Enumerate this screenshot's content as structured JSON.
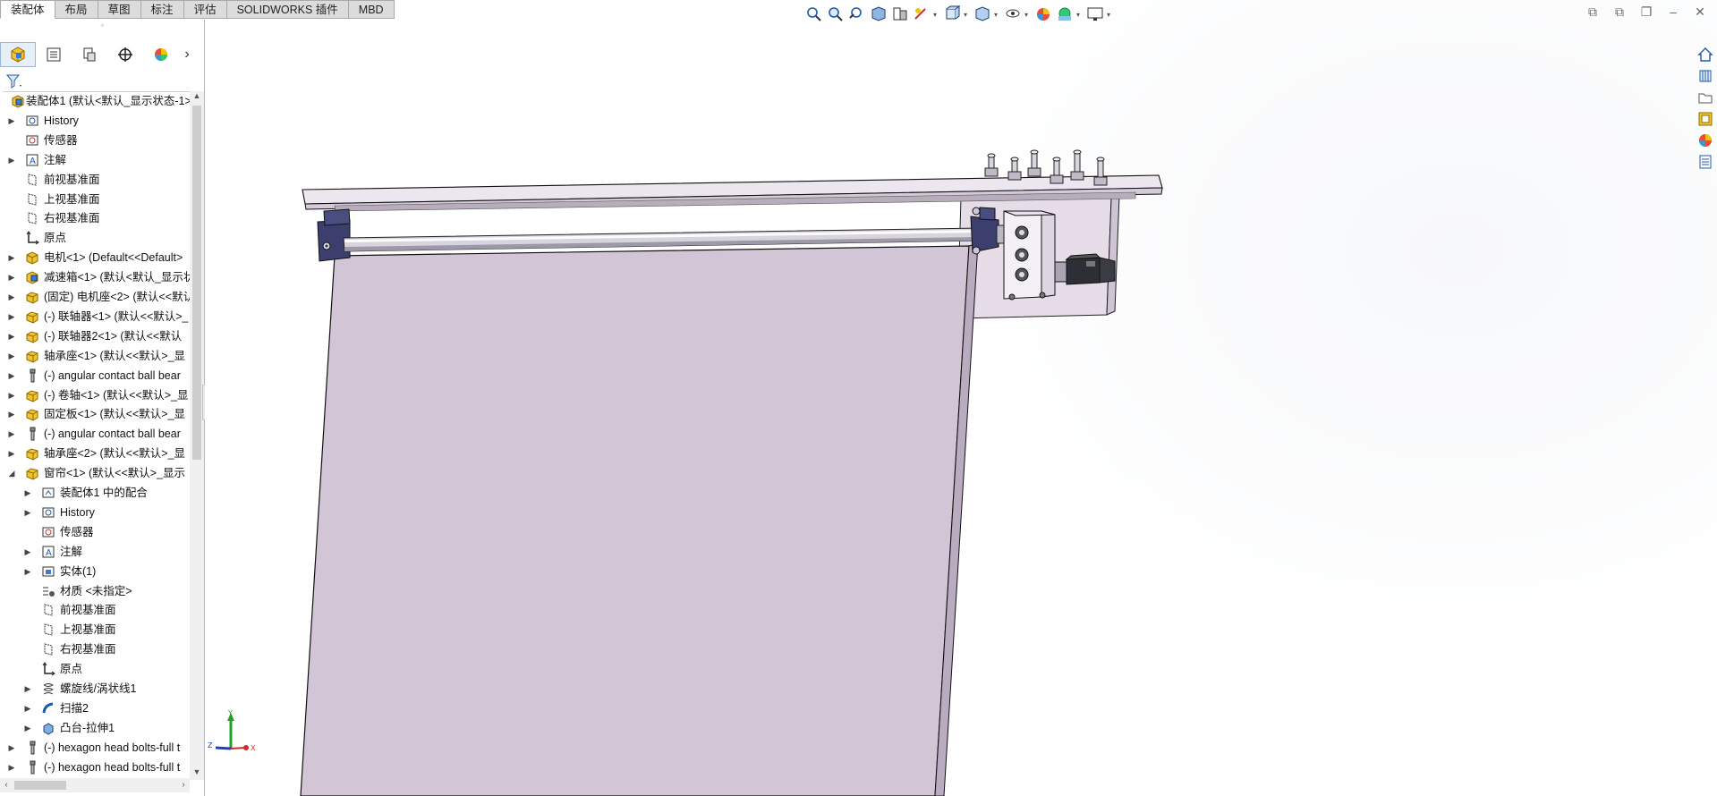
{
  "command_tabs": [
    "装配体",
    "布局",
    "草图",
    "标注",
    "评估",
    "SOLIDWORKS 插件",
    "MBD"
  ],
  "active_tab": "装配体",
  "feature_tree": [
    {
      "label": "装配体1  (默认<默认_显示状态-1>",
      "indent": 0,
      "expand": "",
      "icon": "assembly-icon"
    },
    {
      "label": "History",
      "indent": 1,
      "expand": "collapsed",
      "icon": "history-icon"
    },
    {
      "label": "传感器",
      "indent": 1,
      "expand": "",
      "icon": "sensor-icon"
    },
    {
      "label": "注解",
      "indent": 1,
      "expand": "collapsed",
      "icon": "annotation-icon"
    },
    {
      "label": "前视基准面",
      "indent": 1,
      "expand": "",
      "icon": "plane-icon"
    },
    {
      "label": "上视基准面",
      "indent": 1,
      "expand": "",
      "icon": "plane-icon"
    },
    {
      "label": "右视基准面",
      "indent": 1,
      "expand": "",
      "icon": "plane-icon"
    },
    {
      "label": "原点",
      "indent": 1,
      "expand": "",
      "icon": "origin-icon"
    },
    {
      "label": "电机<1> (Default<<Default>",
      "indent": 1,
      "expand": "collapsed",
      "icon": "subassembly-icon"
    },
    {
      "label": "减速箱<1> (默认<默认_显示状",
      "indent": 1,
      "expand": "collapsed",
      "icon": "subassembly-blue-icon"
    },
    {
      "label": "(固定) 电机座<2> (默认<<默认",
      "indent": 1,
      "expand": "collapsed",
      "icon": "part-icon"
    },
    {
      "label": "(-) 联轴器<1> (默认<<默认>_",
      "indent": 1,
      "expand": "collapsed",
      "icon": "part-icon"
    },
    {
      "label": "(-) 联轴器2<1> (默认<<默认",
      "indent": 1,
      "expand": "collapsed",
      "icon": "part-icon"
    },
    {
      "label": "轴承座<1> (默认<<默认>_显",
      "indent": 1,
      "expand": "collapsed",
      "icon": "part-icon"
    },
    {
      "label": "(-) angular contact ball bear",
      "indent": 1,
      "expand": "collapsed",
      "icon": "toolbox-part-icon"
    },
    {
      "label": "(-) 卷轴<1> (默认<<默认>_显",
      "indent": 1,
      "expand": "collapsed",
      "icon": "part-icon"
    },
    {
      "label": "固定板<1> (默认<<默认>_显",
      "indent": 1,
      "expand": "collapsed",
      "icon": "part-icon"
    },
    {
      "label": "(-) angular contact ball bear",
      "indent": 1,
      "expand": "collapsed",
      "icon": "toolbox-part-icon"
    },
    {
      "label": "轴承座<2> (默认<<默认>_显",
      "indent": 1,
      "expand": "collapsed",
      "icon": "part-icon"
    },
    {
      "label": "窗帘<1> (默认<<默认>_显示",
      "indent": 1,
      "expand": "expanded",
      "icon": "part-icon"
    },
    {
      "label": "装配体1 中的配合",
      "indent": 2,
      "expand": "collapsed",
      "icon": "mates-icon"
    },
    {
      "label": "History",
      "indent": 2,
      "expand": "collapsed",
      "icon": "history-icon"
    },
    {
      "label": "传感器",
      "indent": 2,
      "expand": "",
      "icon": "sensor-icon"
    },
    {
      "label": "注解",
      "indent": 2,
      "expand": "collapsed",
      "icon": "annotation-icon"
    },
    {
      "label": "实体(1)",
      "indent": 2,
      "expand": "collapsed",
      "icon": "solid-bodies-icon"
    },
    {
      "label": "材质 <未指定>",
      "indent": 2,
      "expand": "",
      "icon": "material-icon"
    },
    {
      "label": "前视基准面",
      "indent": 2,
      "expand": "",
      "icon": "plane-icon"
    },
    {
      "label": "上视基准面",
      "indent": 2,
      "expand": "",
      "icon": "plane-icon"
    },
    {
      "label": "右视基准面",
      "indent": 2,
      "expand": "",
      "icon": "plane-icon"
    },
    {
      "label": "原点",
      "indent": 2,
      "expand": "",
      "icon": "origin-icon"
    },
    {
      "label": "螺旋线/涡状线1",
      "indent": 2,
      "expand": "collapsed",
      "icon": "helix-icon"
    },
    {
      "label": "扫描2",
      "indent": 2,
      "expand": "collapsed",
      "icon": "sweep-icon"
    },
    {
      "label": "凸台-拉伸1",
      "indent": 2,
      "expand": "collapsed",
      "icon": "extrude-icon"
    },
    {
      "label": "(-) hexagon head bolts-full t",
      "indent": 1,
      "expand": "collapsed",
      "icon": "toolbox-part-icon"
    },
    {
      "label": "(-) hexagon head bolts-full t",
      "indent": 1,
      "expand": "collapsed",
      "icon": "toolbox-part-icon"
    }
  ],
  "heads_up_toolbar": [
    "zoom-to-fit-icon",
    "zoom-to-area-icon",
    "previous-view-icon",
    "section-view-icon",
    "dynamic-annotation-icon",
    "view-settings-icon",
    "view-orientation-icon",
    "display-style-icon",
    "hide-show-items-icon",
    "edit-appearance-icon",
    "apply-scene-icon",
    "view-setting-display-icon"
  ],
  "triad_labels": {
    "y": "Y",
    "z": "Z",
    "x": "X"
  },
  "colors": {
    "curtain": "#d2c6d6",
    "part_fill": "#ece6ef",
    "edge": "#111111",
    "accent_blue": "#1e6fc2"
  }
}
